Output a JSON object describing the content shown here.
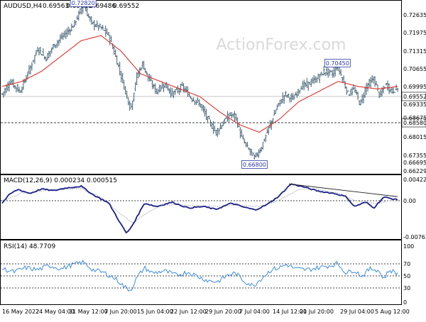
{
  "chart_data": [
    {
      "type": "line",
      "title": "AUDUSD,H4",
      "ohlc": [
        "0.69563",
        "0.69612",
        "0.69486",
        "0.69552"
      ],
      "watermark": "ActionForex.com",
      "ylim": [
        0.66229,
        0.72635
      ],
      "y_ticks": [
        "0.72635",
        "0.71975",
        "0.71315",
        "0.70655",
        "0.69995",
        "0.69335",
        "0.68675",
        "0.68015",
        "0.67355",
        "0.66695",
        "0.66229"
      ],
      "x_ticks": [
        "16 May 2022",
        "24 May 04:00",
        "31 May 12:00",
        "7 Jun 20:00",
        "15 Jun 04:00",
        "22 Jun 12:00",
        "29 Jun 20:00",
        "7 Jul 04:00",
        "14 Jul 12:00",
        "21 Jul 20:00",
        "29 Jul 04:00",
        "5 Aug 12:00"
      ],
      "current_price": "0.69552",
      "support_level": "0.68580",
      "annotations": [
        {
          "label": "0.72820",
          "value": 0.7282,
          "t": 0.205
        },
        {
          "label": "0.66800",
          "value": 0.668,
          "t": 0.638
        },
        {
          "label": "0.70450",
          "value": 0.7045,
          "t": 0.848
        }
      ],
      "price_keypoints": [
        [
          0.0,
          0.693
        ],
        [
          0.02,
          0.698
        ],
        [
          0.045,
          0.694
        ],
        [
          0.07,
          0.703
        ],
        [
          0.09,
          0.711
        ],
        [
          0.11,
          0.707
        ],
        [
          0.13,
          0.712
        ],
        [
          0.155,
          0.716
        ],
        [
          0.18,
          0.72
        ],
        [
          0.205,
          0.7282
        ],
        [
          0.225,
          0.721
        ],
        [
          0.25,
          0.719
        ],
        [
          0.27,
          0.716
        ],
        [
          0.29,
          0.706
        ],
        [
          0.31,
          0.695
        ],
        [
          0.325,
          0.687
        ],
        [
          0.34,
          0.7
        ],
        [
          0.355,
          0.705
        ],
        [
          0.37,
          0.699
        ],
        [
          0.39,
          0.694
        ],
        [
          0.41,
          0.697
        ],
        [
          0.43,
          0.693
        ],
        [
          0.455,
          0.696
        ],
        [
          0.475,
          0.692
        ],
        [
          0.5,
          0.689
        ],
        [
          0.52,
          0.683
        ],
        [
          0.54,
          0.678
        ],
        [
          0.56,
          0.682
        ],
        [
          0.575,
          0.685
        ],
        [
          0.59,
          0.684
        ],
        [
          0.605,
          0.676
        ],
        [
          0.62,
          0.672
        ],
        [
          0.638,
          0.668
        ],
        [
          0.655,
          0.672
        ],
        [
          0.675,
          0.68
        ],
        [
          0.695,
          0.688
        ],
        [
          0.715,
          0.693
        ],
        [
          0.735,
          0.691
        ],
        [
          0.755,
          0.696
        ],
        [
          0.775,
          0.697
        ],
        [
          0.795,
          0.699
        ],
        [
          0.815,
          0.702
        ],
        [
          0.835,
          0.701
        ],
        [
          0.848,
          0.7045
        ],
        [
          0.86,
          0.699
        ],
        [
          0.875,
          0.693
        ],
        [
          0.89,
          0.695
        ],
        [
          0.905,
          0.689
        ],
        [
          0.92,
          0.696
        ],
        [
          0.94,
          0.699
        ],
        [
          0.955,
          0.692
        ],
        [
          0.97,
          0.697
        ],
        [
          0.985,
          0.694
        ],
        [
          1.0,
          0.6955
        ]
      ],
      "ma_keypoints": [
        [
          0.0,
          0.696
        ],
        [
          0.05,
          0.698
        ],
        [
          0.1,
          0.702
        ],
        [
          0.15,
          0.708
        ],
        [
          0.2,
          0.714
        ],
        [
          0.25,
          0.716
        ],
        [
          0.3,
          0.71
        ],
        [
          0.35,
          0.701
        ],
        [
          0.4,
          0.698
        ],
        [
          0.45,
          0.695
        ],
        [
          0.5,
          0.692
        ],
        [
          0.55,
          0.686
        ],
        [
          0.6,
          0.681
        ],
        [
          0.65,
          0.678
        ],
        [
          0.7,
          0.683
        ],
        [
          0.75,
          0.69
        ],
        [
          0.8,
          0.694
        ],
        [
          0.85,
          0.698
        ],
        [
          0.9,
          0.696
        ],
        [
          0.95,
          0.695
        ],
        [
          1.0,
          0.696
        ]
      ]
    },
    {
      "type": "line",
      "title": "MACD(12,26,9) 0.000234 0.000515",
      "ylim": [
        -0.007633,
        0.004229
      ],
      "y_ticks": [
        "0.004229",
        "0.00",
        "-0.007633"
      ],
      "macd_keypoints": [
        [
          0.0,
          -0.0005
        ],
        [
          0.02,
          0.0015
        ],
        [
          0.04,
          0.0025
        ],
        [
          0.07,
          0.0016
        ],
        [
          0.1,
          0.0026
        ],
        [
          0.13,
          0.0022
        ],
        [
          0.16,
          0.0028
        ],
        [
          0.2,
          0.0032
        ],
        [
          0.23,
          0.0013
        ],
        [
          0.27,
          -0.0005
        ],
        [
          0.3,
          -0.0048
        ],
        [
          0.315,
          -0.0068
        ],
        [
          0.33,
          -0.005
        ],
        [
          0.36,
          -0.0005
        ],
        [
          0.39,
          -0.0012
        ],
        [
          0.43,
          -0.0003
        ],
        [
          0.47,
          -0.0015
        ],
        [
          0.51,
          -0.0012
        ],
        [
          0.54,
          -0.0018
        ],
        [
          0.58,
          -0.0005
        ],
        [
          0.61,
          -0.0013
        ],
        [
          0.64,
          -0.0019
        ],
        [
          0.67,
          -0.0008
        ],
        [
          0.7,
          0.001
        ],
        [
          0.73,
          0.0037
        ],
        [
          0.76,
          0.0031
        ],
        [
          0.8,
          0.0021
        ],
        [
          0.84,
          0.0016
        ],
        [
          0.87,
          0.0009
        ],
        [
          0.89,
          -0.0012
        ],
        [
          0.92,
          -0.0003
        ],
        [
          0.94,
          -0.0015
        ],
        [
          0.965,
          0.0008
        ],
        [
          1.0,
          0.0002
        ]
      ],
      "signal_keypoints": [
        [
          0.0,
          0.0
        ],
        [
          0.05,
          0.0017
        ],
        [
          0.1,
          0.0022
        ],
        [
          0.15,
          0.0025
        ],
        [
          0.2,
          0.0027
        ],
        [
          0.25,
          0.0008
        ],
        [
          0.3,
          -0.0028
        ],
        [
          0.33,
          -0.0046
        ],
        [
          0.36,
          -0.0028
        ],
        [
          0.4,
          -0.001
        ],
        [
          0.45,
          -0.0008
        ],
        [
          0.5,
          -0.0011
        ],
        [
          0.55,
          -0.0012
        ],
        [
          0.6,
          -0.0009
        ],
        [
          0.65,
          -0.0012
        ],
        [
          0.7,
          0.0001
        ],
        [
          0.75,
          0.0025
        ],
        [
          0.8,
          0.0025
        ],
        [
          0.85,
          0.0017
        ],
        [
          0.9,
          -0.0002
        ],
        [
          0.95,
          -0.0006
        ],
        [
          1.0,
          0.0005
        ]
      ],
      "trendline": [
        [
          0.725,
          0.0037
        ],
        [
          1.0,
          0.0009
        ]
      ]
    },
    {
      "type": "line",
      "title": "RSI(14) 48.7709",
      "ylim": [
        0,
        100
      ],
      "y_ticks": [
        "100",
        "70",
        "50",
        "30",
        "0"
      ],
      "rsi_keypoints": [
        [
          0.0,
          58
        ],
        [
          0.03,
          52
        ],
        [
          0.06,
          60
        ],
        [
          0.09,
          56
        ],
        [
          0.12,
          64
        ],
        [
          0.15,
          58
        ],
        [
          0.18,
          66
        ],
        [
          0.205,
          70
        ],
        [
          0.23,
          56
        ],
        [
          0.26,
          50
        ],
        [
          0.29,
          38
        ],
        [
          0.31,
          24
        ],
        [
          0.325,
          18
        ],
        [
          0.34,
          40
        ],
        [
          0.36,
          60
        ],
        [
          0.38,
          50
        ],
        [
          0.41,
          54
        ],
        [
          0.44,
          46
        ],
        [
          0.47,
          52
        ],
        [
          0.5,
          42
        ],
        [
          0.52,
          36
        ],
        [
          0.545,
          34
        ],
        [
          0.57,
          46
        ],
        [
          0.59,
          50
        ],
        [
          0.61,
          36
        ],
        [
          0.635,
          26
        ],
        [
          0.655,
          40
        ],
        [
          0.68,
          56
        ],
        [
          0.7,
          60
        ],
        [
          0.72,
          66
        ],
        [
          0.74,
          58
        ],
        [
          0.77,
          56
        ],
        [
          0.8,
          60
        ],
        [
          0.83,
          64
        ],
        [
          0.848,
          68
        ],
        [
          0.87,
          50
        ],
        [
          0.89,
          56
        ],
        [
          0.91,
          44
        ],
        [
          0.93,
          58
        ],
        [
          0.95,
          56
        ],
        [
          0.965,
          40
        ],
        [
          0.98,
          56
        ],
        [
          1.0,
          49
        ]
      ]
    }
  ]
}
